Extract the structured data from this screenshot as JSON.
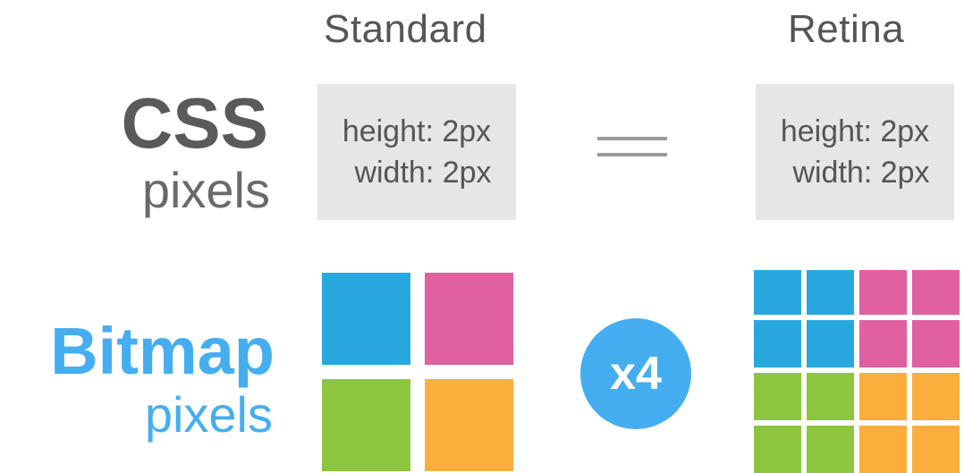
{
  "columns": {
    "standard": "Standard",
    "retina": "Retina"
  },
  "rows": {
    "css": {
      "title": "CSS",
      "subtitle": "pixels"
    },
    "bitmap": {
      "title": "Bitmap",
      "subtitle": "pixels"
    }
  },
  "standard_box": {
    "height": "height: 2px",
    "width": "width: 2px"
  },
  "retina_box": {
    "height": "height: 2px",
    "width": "width: 2px"
  },
  "equals": "==",
  "multiplier": "x4",
  "colors": {
    "blue": "#29a8e0",
    "pink": "#e060a0",
    "green": "#8cc63f",
    "orange": "#fbae3c",
    "bitmap_text": "#45aef0",
    "badge": "#45aef0"
  },
  "standard_grid": {
    "size": 2,
    "cells": [
      "blue",
      "pink",
      "green",
      "orange"
    ]
  },
  "retina_grid": {
    "size": 4,
    "cells": [
      "blue",
      "blue",
      "pink",
      "pink",
      "blue",
      "blue",
      "pink",
      "pink",
      "green",
      "green",
      "orange",
      "orange",
      "green",
      "green",
      "orange",
      "orange"
    ]
  }
}
